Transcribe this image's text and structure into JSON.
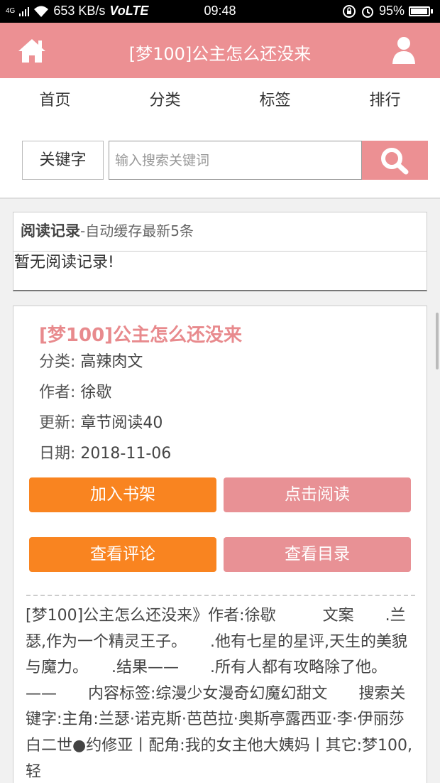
{
  "status_bar": {
    "network": "4G",
    "speed": "653 KB/s",
    "volte": "VoLTE",
    "time": "09:48",
    "battery": "95%"
  },
  "header": {
    "title": "[梦100]公主怎么还没来",
    "home_icon": "home-icon",
    "user_icon": "user-icon"
  },
  "nav": {
    "items": [
      "首页",
      "分类",
      "标签",
      "排行"
    ]
  },
  "search": {
    "keyword_label": "关键字",
    "placeholder": "输入搜索关键词",
    "button_icon": "search-icon"
  },
  "history": {
    "title": "阅读记录",
    "subtitle": "-自动缓存最新5条",
    "empty": "暂无阅读记录!"
  },
  "book": {
    "title": "[梦100]公主怎么还没来",
    "category_label": "分类:",
    "category": "高辣肉文",
    "author_label": "作者:",
    "author": "徐歇",
    "update_label": "更新:",
    "update": "章节阅读40",
    "date_label": "日期:",
    "date": "2018-11-06",
    "buttons": {
      "add_shelf": "加入书架",
      "read": "点击阅读",
      "comments": "查看评论",
      "toc": "查看目录"
    },
    "description": "[梦100]公主怎么还没来》作者:徐歇　　　文案　　.兰瑟,作为一个精灵王子。　　.他有七星的星评,天生的美貌与魔力。　　.结果——　　.所有人都有攻略除了他。　　——　　内容标签:综漫少女漫奇幻魔幻甜文　　搜索关键字:主角:兰瑟·诺克斯·芭芭拉·奥斯亭露西亚·李·伊丽莎白二世●约修亚丨配角:我的女主他大姨妈丨其它:梦100,轻"
  },
  "colors": {
    "header_bg": "#ec9093",
    "orange_button": "#f98420",
    "pink_button": "#e89195",
    "title_pink": "#e88a8d"
  }
}
